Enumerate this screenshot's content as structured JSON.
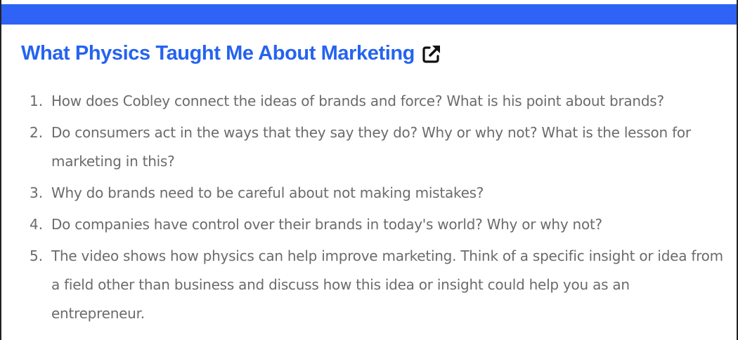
{
  "header": {
    "accent_color": "#2f63f5",
    "title": "What Physics Taught Me About Marketing",
    "title_color": "#2563f0",
    "link_icon": "external-link-icon"
  },
  "questions": [
    {
      "number": "1.",
      "text": "How does Cobley connect the ideas of brands and force? What is his point about brands?"
    },
    {
      "number": "2.",
      "text": "Do consumers act in the ways that they say they do? Why or why not? What is the lesson for marketing in this?"
    },
    {
      "number": "3.",
      "text": "Why do brands need to be careful about not making mistakes?"
    },
    {
      "number": "4.",
      "text": "Do companies have control over their brands in today's world? Why or why not?"
    },
    {
      "number": "5.",
      "text": "The video shows how physics can help improve marketing. Think of a specific insight or idea from a field other than business and discuss how this idea or insight could help you as an entrepreneur."
    }
  ]
}
